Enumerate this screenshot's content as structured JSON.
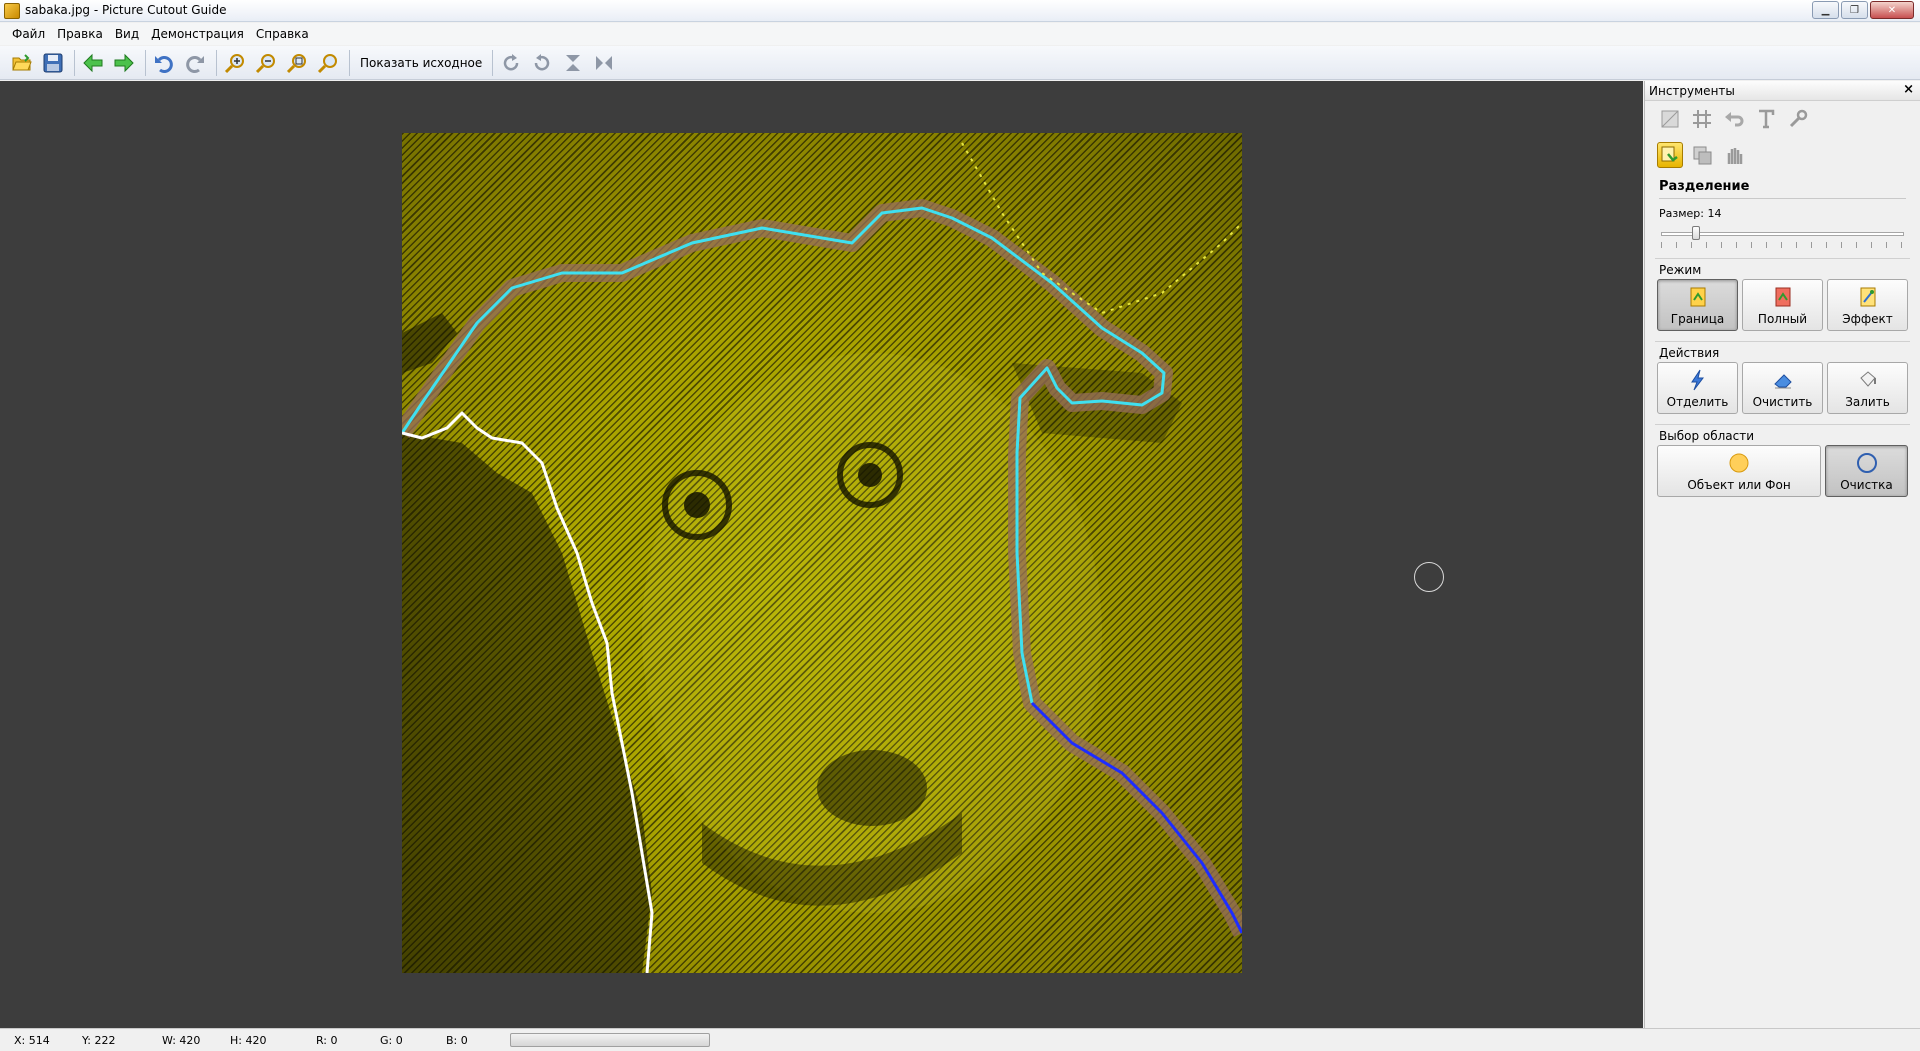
{
  "window": {
    "title": "sabaka.jpg - Picture Cutout Guide"
  },
  "menu": [
    "Файл",
    "Правка",
    "Вид",
    "Демонстрация",
    "Справка"
  ],
  "toolbar": {
    "show_original_label": "Показать исходное"
  },
  "panel": {
    "title": "Инструменты",
    "close_glyph": "×",
    "section_title": "Разделение",
    "size_label": "Размер: 14",
    "size_value": 14,
    "mode": {
      "label": "Режим",
      "buttons": [
        "Граница",
        "Полный",
        "Эффект"
      ],
      "active": "Граница"
    },
    "actions": {
      "label": "Действия",
      "buttons": [
        "Отделить",
        "Очистить",
        "Залить"
      ]
    },
    "selection": {
      "label": "Выбор области",
      "buttons": [
        "Объект или Фон",
        "Очистка"
      ],
      "active": "Очистка"
    }
  },
  "status": {
    "x": "X: 514",
    "y": "Y: 222",
    "w": "W: 420",
    "h": "H: 420",
    "r": "R: 0",
    "g": "G: 0",
    "b": "B: 0"
  },
  "colors": {
    "canvas_bg": "#3d3d3d",
    "photo_tint": "#a9a300",
    "outline_cyan": "#3fe0f0",
    "outline_white": "#ffffff",
    "outline_blue": "#1d2cff"
  }
}
